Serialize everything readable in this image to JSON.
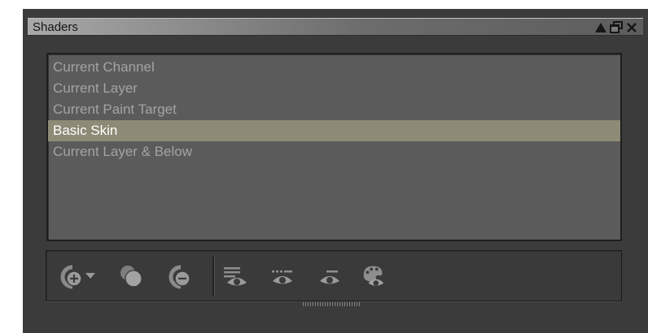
{
  "panel": {
    "title": "Shaders",
    "title_buttons": [
      "collapse-icon",
      "undock-icon",
      "close-icon"
    ]
  },
  "shader_list": {
    "items": [
      {
        "label": "Current Channel",
        "selected": false
      },
      {
        "label": "Current Layer",
        "selected": false
      },
      {
        "label": "Current Paint Target",
        "selected": false
      },
      {
        "label": "Basic Skin",
        "selected": true
      },
      {
        "label": "Current Layer & Below",
        "selected": false
      }
    ]
  },
  "toolbar": {
    "icons": [
      "add-shader-icon",
      "dropdown-arrow-icon",
      "duplicate-shader-icon",
      "remove-shader-icon",
      "show-shader-layers-icon",
      "show-shader-channels-icon",
      "show-shader-icon",
      "paint-shader-icon"
    ]
  },
  "colors": {
    "panel_bg": "#3b3b3b",
    "list_bg": "#5b5b5b",
    "selection_bg": "#8d8a76",
    "item_text": "#a3a3a3",
    "selected_text": "#ffffff"
  }
}
